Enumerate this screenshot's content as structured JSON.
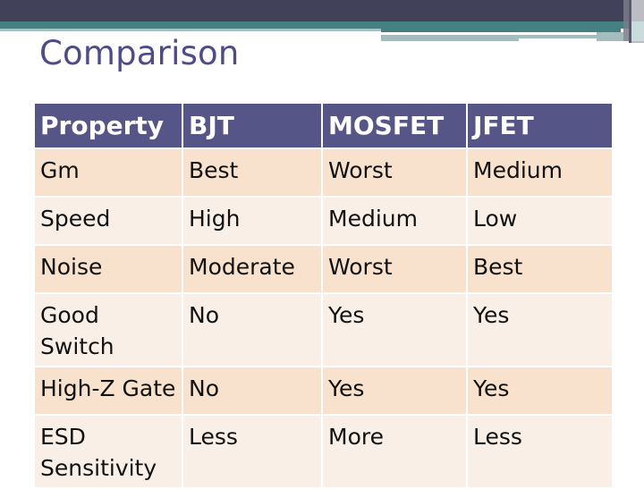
{
  "slide": {
    "title": "Comparison"
  },
  "table": {
    "headers": [
      "Property",
      "BJT",
      "MOSFET",
      "JFET"
    ],
    "rows": [
      [
        "Gm",
        "Best",
        "Worst",
        "Medium"
      ],
      [
        "Speed",
        "High",
        "Medium",
        "Low"
      ],
      [
        "Noise",
        "Moderate",
        "Worst",
        "Best"
      ],
      [
        "Good Switch",
        "No",
        "Yes",
        "Yes"
      ],
      [
        "High-Z Gate",
        "No",
        "Yes",
        "Yes"
      ],
      [
        "ESD Sensitivity",
        "Less",
        "More",
        "Less"
      ]
    ]
  },
  "colors": {
    "header_bg": "#555587",
    "row_odd": "#f8e2cd",
    "row_even": "#faefe6",
    "title": "#4c4c8c",
    "band_dark": "#41425a",
    "band_teal": "#458083"
  }
}
